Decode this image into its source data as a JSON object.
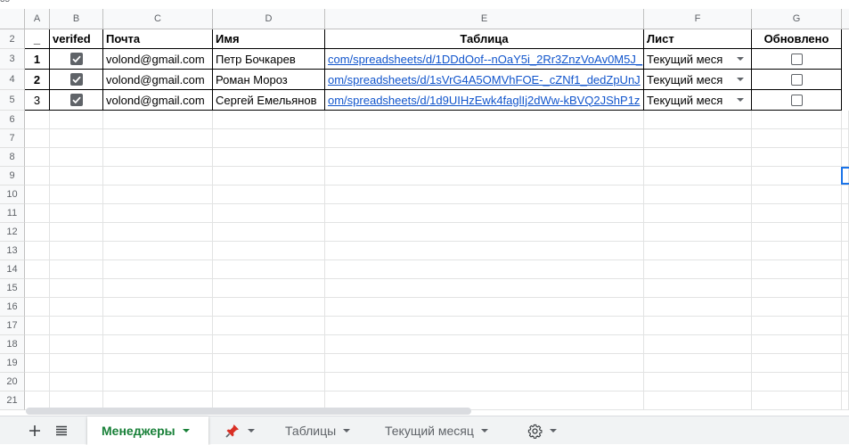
{
  "top_fragment": "35",
  "columns": [
    "A",
    "B",
    "C",
    "D",
    "E",
    "F",
    "G"
  ],
  "row_numbers": [
    "2",
    "3",
    "4",
    "5",
    "6",
    "7",
    "8",
    "9",
    "10",
    "11",
    "12",
    "13",
    "14",
    "15",
    "16",
    "17",
    "18",
    "19",
    "20",
    "21"
  ],
  "header_row": {
    "a": "_",
    "b": "verifed",
    "c": "Почта",
    "d": "Имя",
    "e": "Таблица",
    "f": "Лист",
    "g": "Обновлено"
  },
  "rows": [
    {
      "num": "1",
      "verified": true,
      "email": "volond@gmail.com",
      "name": "Петр Бочкарев",
      "table": "com/spreadsheets/d/1DDdOof--nOaY5i_2Rr3ZnzVoAv0M5J_",
      "sheet": "Текущий меся",
      "updated": false
    },
    {
      "num": "2",
      "verified": true,
      "email": "volond@gmail.com",
      "name": "Роман Мороз",
      "table": "om/spreadsheets/d/1sVrG4A5OMVhFOE-_cZNf1_dedZpUnJ",
      "sheet": "Текущий меся",
      "updated": false
    },
    {
      "num": "3",
      "verified": true,
      "email": "volond@gmail.com",
      "name": "Сергей Емельянов",
      "table": "om/spreadsheets/d/1d9UIHzEwk4faglIj2dWw-kBVQ2JShP1z",
      "sheet": "Текущий меся",
      "updated": false
    }
  ],
  "tabs": [
    {
      "label": "Менеджеры",
      "active": true
    },
    {
      "label": "",
      "icon": "pushpin-icon"
    },
    {
      "label": "Таблицы"
    },
    {
      "label": "Текущий месяц"
    },
    {
      "label": "",
      "icon": "gear-icon"
    }
  ],
  "colors": {
    "active_tab": "#188038",
    "link": "#1155cc",
    "selection": "#1a73e8"
  }
}
